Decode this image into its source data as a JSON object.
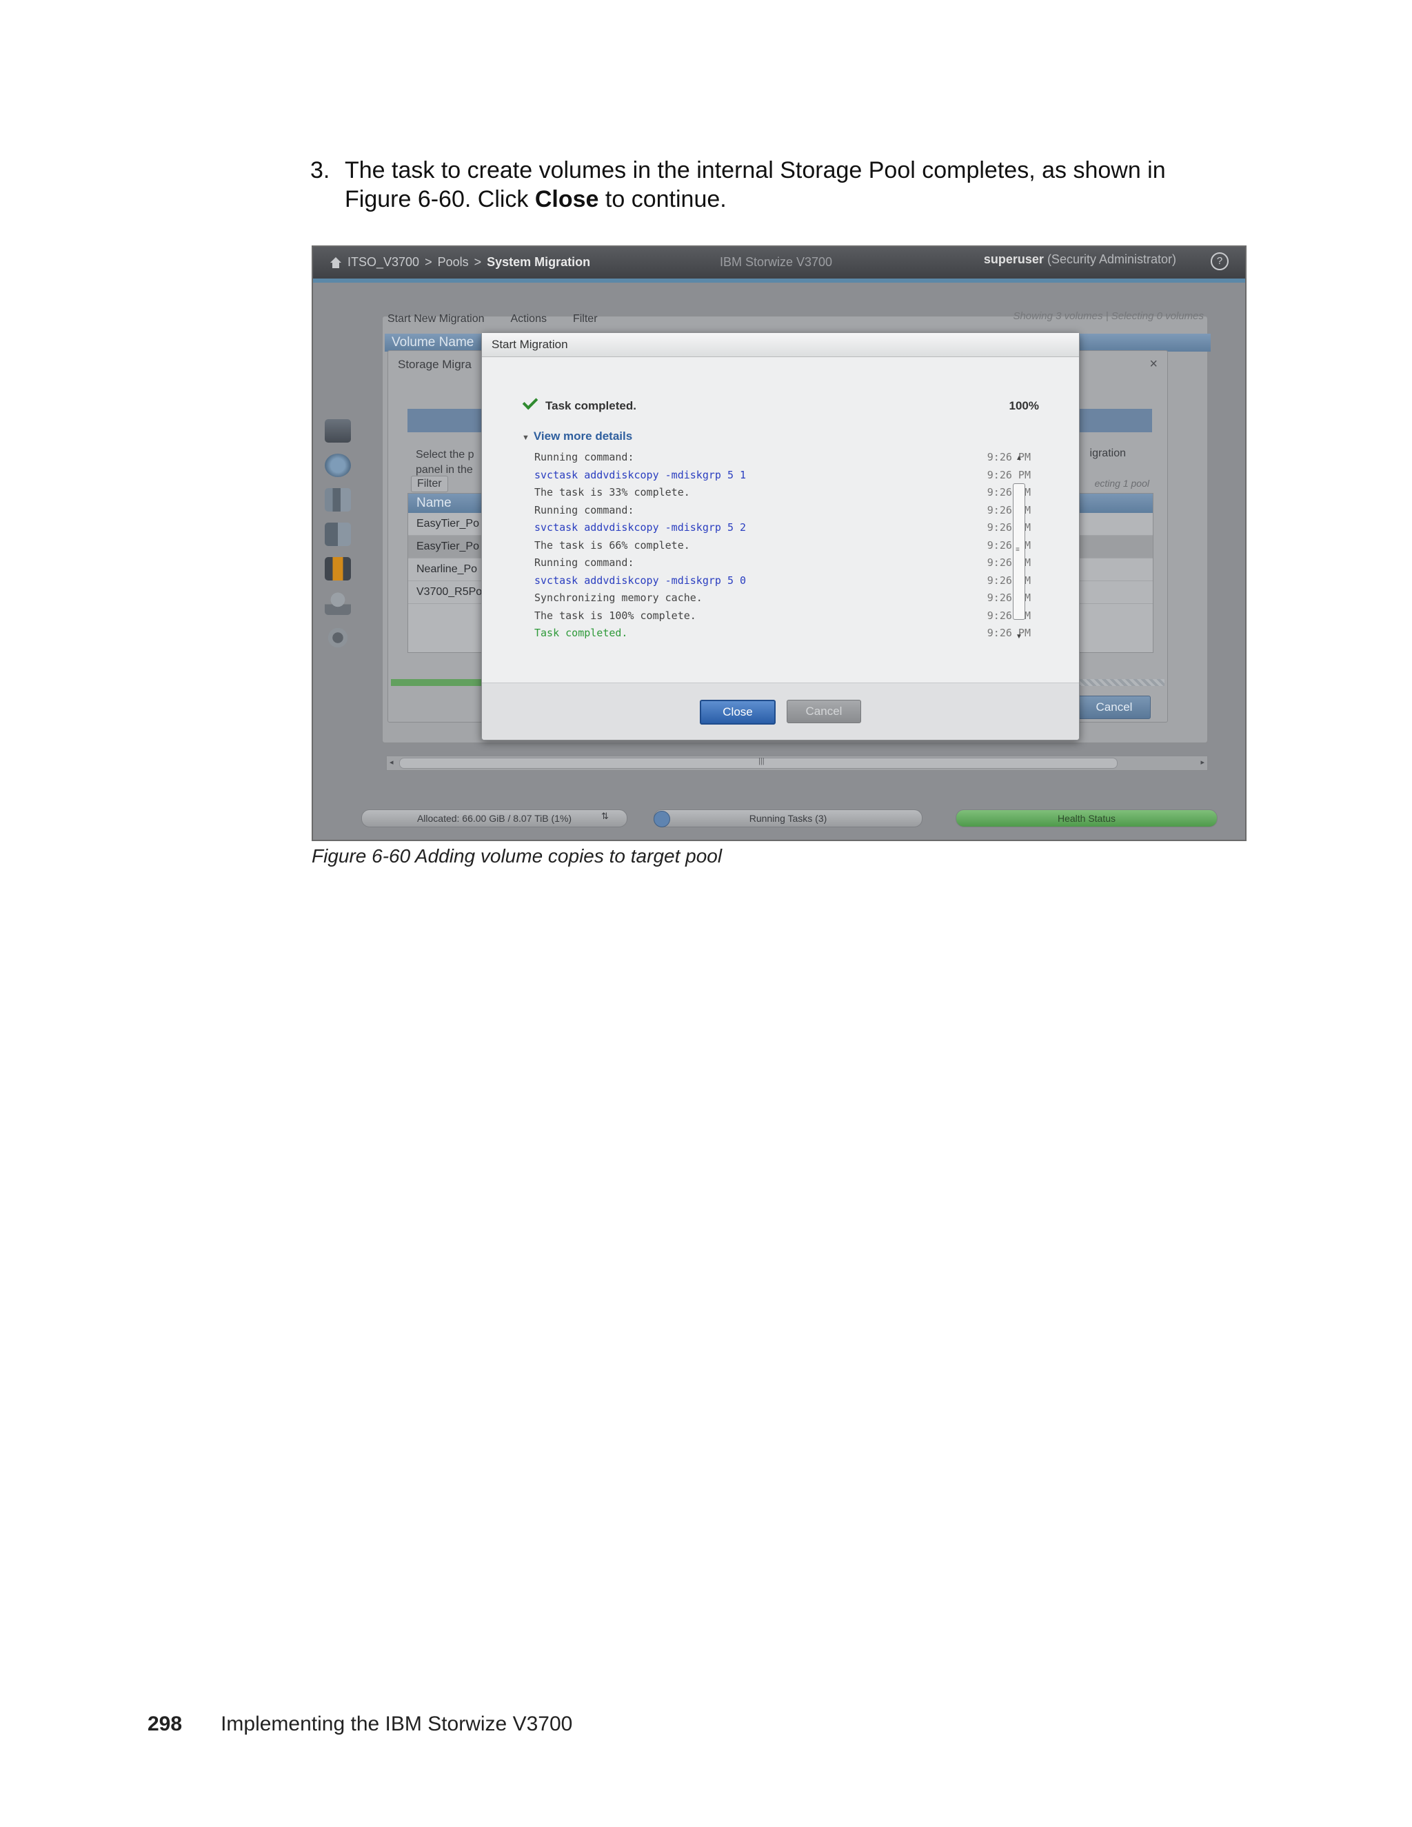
{
  "step": {
    "number": "3.",
    "text_before": "The task to create volumes in the internal Storage Pool completes, as shown in Figure 6-60. Click ",
    "emphasis": "Close",
    "text_after": " to continue."
  },
  "screenshot": {
    "topbar": {
      "crumb_1": "ITSO_V3700",
      "sep": ">",
      "crumb_2": "Pools",
      "crumb_3": "System Migration",
      "product": "IBM Storwize V3700",
      "user": "superuser",
      "role": "(Security Administrator)"
    },
    "toolbar": {
      "start_new_migration": "Start New Migration",
      "actions": "Actions",
      "filter": "Filter"
    },
    "showing": "Showing 3 volumes | Selecting 0 volumes",
    "column_header": "Volume Name",
    "migration_window": {
      "title": "Storage Migra",
      "select_text_1": "Select the p",
      "select_text_2": "panel in the",
      "migration_title": "igration",
      "selecting": "ecting 1 pool",
      "filter": "Filter",
      "table_header": "Name",
      "rows": [
        "EasyTier_Po",
        "EasyTier_Po",
        "Nearline_Po",
        "V3700_R5Po"
      ],
      "cancel": "Cancel"
    },
    "status": {
      "allocated": "Allocated: 66.00 GiB / 8.07 TiB (1%)",
      "running_tasks": "Running Tasks (3)",
      "health": "Health Status"
    },
    "dialog": {
      "title": "Start Migration",
      "task_label": "Task completed.",
      "percent": "100%",
      "details_toggle": "View more details",
      "log": [
        {
          "text": "Running command:",
          "time": "9:26 PM",
          "kind": "plain"
        },
        {
          "text": "svctask addvdiskcopy -mdiskgrp 5 1",
          "time": "9:26 PM",
          "kind": "cmd"
        },
        {
          "text": "The task is 33% complete.",
          "time": "9:26 PM",
          "kind": "plain"
        },
        {
          "text": "Running command:",
          "time": "9:26 PM",
          "kind": "plain"
        },
        {
          "text": "svctask addvdiskcopy -mdiskgrp 5 2",
          "time": "9:26 PM",
          "kind": "cmd"
        },
        {
          "text": "The task is 66% complete.",
          "time": "9:26 PM",
          "kind": "plain"
        },
        {
          "text": "Running command:",
          "time": "9:26 PM",
          "kind": "plain"
        },
        {
          "text": "svctask addvdiskcopy -mdiskgrp 5 0",
          "time": "9:26 PM",
          "kind": "cmd"
        },
        {
          "text": "Synchronizing memory cache.",
          "time": "9:26 PM",
          "kind": "plain"
        },
        {
          "text": "The task is 100% complete.",
          "time": "9:26 PM",
          "kind": "plain"
        },
        {
          "text": "Task completed.",
          "time": "9:26 PM",
          "kind": "ok"
        }
      ],
      "close_label": "Close",
      "cancel_label": "Cancel"
    }
  },
  "caption": "Figure 6-60   Adding volume copies to target pool",
  "footer": {
    "page_number": "298",
    "book_title": "Implementing the IBM Storwize V3700"
  }
}
